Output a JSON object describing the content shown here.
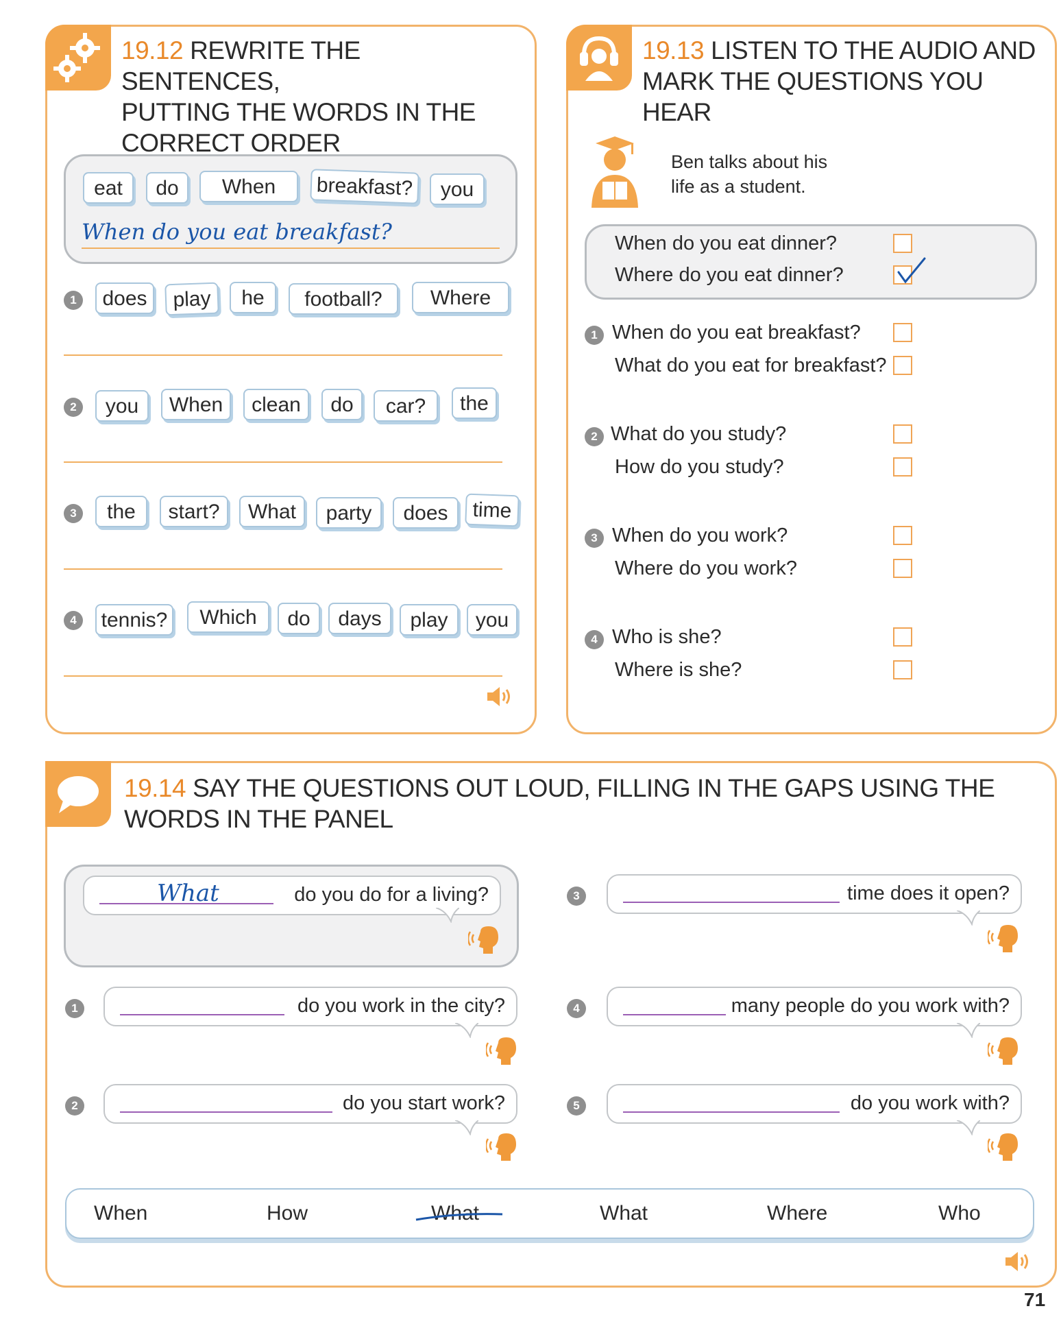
{
  "ex1912": {
    "number": "19.12",
    "title_l1": "REWRITE THE SENTENCES,",
    "title_l2": "PUTTING THE WORDS IN THE",
    "title_l3": "CORRECT ORDER",
    "example_words": [
      "eat",
      "do",
      "When",
      "breakfast?",
      "you"
    ],
    "example_answer": "When do you eat breakfast?",
    "items": [
      {
        "num": "1",
        "words": [
          "does",
          "play",
          "he",
          "football?",
          "Where"
        ]
      },
      {
        "num": "2",
        "words": [
          "you",
          "When",
          "clean",
          "do",
          "car?",
          "the"
        ]
      },
      {
        "num": "3",
        "words": [
          "the",
          "start?",
          "What",
          "party",
          "does",
          "time"
        ]
      },
      {
        "num": "4",
        "words": [
          "tennis?",
          "Which",
          "do",
          "days",
          "play",
          "you"
        ]
      }
    ]
  },
  "ex1913": {
    "number": "19.13",
    "title_l1": "LISTEN TO THE AUDIO AND",
    "title_l2": "MARK THE QUESTIONS YOU HEAR",
    "intro_l1": "Ben talks about his",
    "intro_l2": "life as a student.",
    "example": [
      "When do you eat dinner?",
      "Where do you eat dinner?"
    ],
    "example_checked": 1,
    "items": [
      {
        "num": "1",
        "q1": "When do you eat breakfast?",
        "q2": "What do you eat for breakfast?"
      },
      {
        "num": "2",
        "q1": "What do you study?",
        "q2": "How do you study?"
      },
      {
        "num": "3",
        "q1": "When do you work?",
        "q2": "Where do you work?"
      },
      {
        "num": "4",
        "q1": "Who is she?",
        "q2": "Where is she?"
      }
    ]
  },
  "ex1914": {
    "number": "19.14",
    "title_l1": "SAY THE QUESTIONS OUT LOUD, FILLING IN THE GAPS USING THE",
    "title_l2": "WORDS IN THE PANEL",
    "example_answer": "What",
    "example_text": "do you do for a living?",
    "items": [
      {
        "num": "1",
        "text": "do you work in the city?"
      },
      {
        "num": "2",
        "text": "do you start work?"
      },
      {
        "num": "3",
        "text": "time does it open?"
      },
      {
        "num": "4",
        "text": "many people do you work with?"
      },
      {
        "num": "5",
        "text": "do you work with?"
      }
    ],
    "panel_words": [
      "When",
      "How",
      "What",
      "What",
      "Where",
      "Who"
    ],
    "crossed_index": 2
  },
  "page_number": "71",
  "colors": {
    "accent": "#f3a64c",
    "title_number": "#e9892a",
    "handwriting": "#1b56a8",
    "gap_line": "#9b5fb5"
  }
}
